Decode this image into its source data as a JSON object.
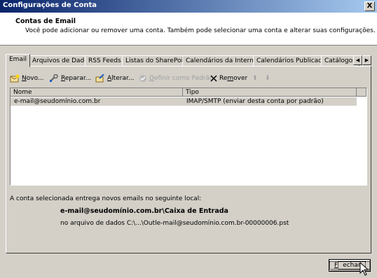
{
  "window": {
    "title": "Configurações de Conta",
    "close_glyph": "X"
  },
  "header": {
    "title": "Contas de Email",
    "description": "Você pode adicionar ou remover uma conta. Também pode selecionar uma conta e alterar suas configurações."
  },
  "tabs": [
    "Email",
    "Arquivos de Dados",
    "RSS Feeds",
    "Listas do SharePoint",
    "Calendários da Internet",
    "Calendários Publicados",
    "Catálogos"
  ],
  "tab_scroll": {
    "left": "◀",
    "right": "▶"
  },
  "toolbar": {
    "new": {
      "accel": "N",
      "rest": "ovo..."
    },
    "repair": {
      "accel": "R",
      "rest": "eparar..."
    },
    "change": {
      "accel": "A",
      "rest": "lterar..."
    },
    "set_default": {
      "accel": "D",
      "rest": "efinir como Padrão"
    },
    "remove": {
      "pre": "Re",
      "accel": "m",
      "rest": "over"
    },
    "up_arrow": "⬆",
    "down_arrow": "⬇"
  },
  "list": {
    "columns": [
      "Nome",
      "Tipo"
    ],
    "rows": [
      {
        "name": "e-mail@seudomínio.com.br",
        "type": "IMAP/SMTP (enviar desta conta por padrão)"
      }
    ]
  },
  "delivery": {
    "label": "A conta selecionada entrega novos emails no seguinte local:",
    "location": "e-mail@seudomínio.com.br\\Caixa de Entrada",
    "file": "no arquivo de dados C:\\...\\Outle-mail@seudomínio.com.br-00000006.pst"
  },
  "close_button": {
    "accel": "F",
    "rest": "echar"
  }
}
